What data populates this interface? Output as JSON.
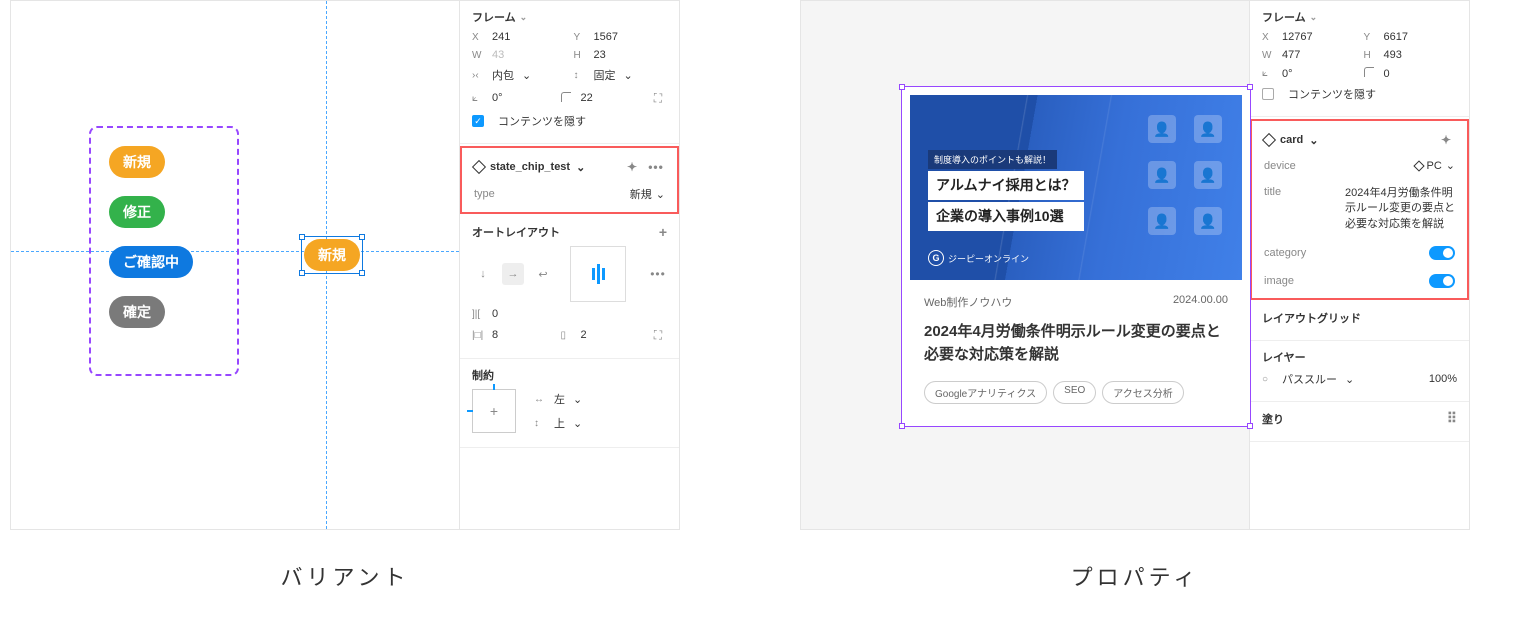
{
  "left": {
    "caption": "バリアント",
    "chips": [
      "新規",
      "修正",
      "ご確認中",
      "確定"
    ],
    "selected_chip": "新規",
    "inspector": {
      "frame_title": "フレーム",
      "x": "241",
      "y": "1567",
      "w": "43",
      "h": "23",
      "hresize_lbl": "内包",
      "vresize_lbl": "固定",
      "rotate": "0°",
      "corner": "22",
      "clip_label": "コンテンツを隠す",
      "component_name": "state_chip_test",
      "prop_label": "type",
      "prop_value": "新規",
      "autolayout_title": "オートレイアウト",
      "gap": "0",
      "pad_h": "8",
      "pad_v": "2",
      "constraints_title": "制約",
      "constraint_h": "左",
      "constraint_v": "上"
    }
  },
  "right": {
    "caption": "プロパティ",
    "card": {
      "overlay_badge": "制度導入のポイントも解説！",
      "overlay_line1": "アルムナイ採用とは？",
      "overlay_line2": "企業の導入事例10選",
      "logo_text": "ジーピーオンライン",
      "category": "Web制作ノウハウ",
      "date": "2024.00.00",
      "title": "2024年4月労働条件明示ルール変更の要点と必要な対応策を解説",
      "tags": [
        "Googleアナリティクス",
        "SEO",
        "アクセス分析"
      ]
    },
    "inspector": {
      "frame_title": "フレーム",
      "x": "12767",
      "y": "6617",
      "w": "477",
      "h": "493",
      "rotate": "0°",
      "corner": "0",
      "clip_label": "コンテンツを隠す",
      "component_name": "card",
      "prop_device_label": "device",
      "prop_device_value": "PC",
      "prop_title_label": "title",
      "prop_title_value": "2024年4月労働条件明示ルール変更の要点と必要な対応策を解説",
      "prop_category_label": "category",
      "prop_image_label": "image",
      "layoutgrid_title": "レイアウトグリッド",
      "layer_title": "レイヤー",
      "passthrough": "パススルー",
      "opacity": "100%",
      "fill_title": "塗り"
    }
  }
}
